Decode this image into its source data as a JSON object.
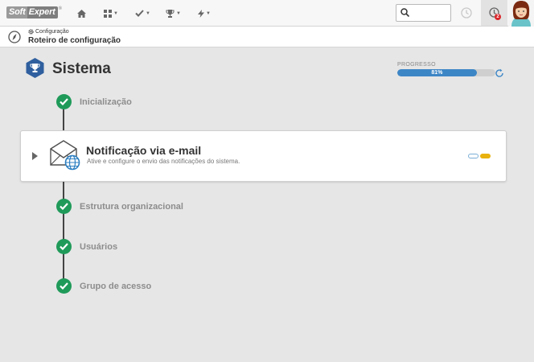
{
  "header": {
    "logo_part1": "Soft",
    "logo_part2": "Expert",
    "logo_mark": "®",
    "nav": [
      {
        "icon": "home-icon"
      },
      {
        "icon": "grid-icon"
      },
      {
        "icon": "check-icon"
      },
      {
        "icon": "trophy-icon"
      },
      {
        "icon": "bolt-icon"
      }
    ],
    "search": {
      "value": "",
      "placeholder": ""
    },
    "notifications": {
      "count": "2",
      "icon": "bell-icon"
    },
    "avatar": "user-avatar"
  },
  "breadcrumb": {
    "parent": "Configuração",
    "title": "Roteiro de configuração"
  },
  "main": {
    "title": "Sistema",
    "progress": {
      "label": "PROGRESSO",
      "text": "81%",
      "value": 0.81,
      "color": "#3d86c6"
    },
    "steps": [
      {
        "label": "Inicialização",
        "status": "done"
      },
      {
        "label": "Estrutura organizacional",
        "status": "done"
      },
      {
        "label": "Usuários",
        "status": "done"
      },
      {
        "label": "Grupo de acesso",
        "status": "done"
      }
    ],
    "active_card": {
      "title": "Notificação via e-mail",
      "description": "Ative e configure o envio das notificações do sistema."
    }
  },
  "colors": {
    "accent": "#3d86c6",
    "success": "#1f9a59",
    "warning": "#e8b10d",
    "badge": "#d9262b"
  }
}
